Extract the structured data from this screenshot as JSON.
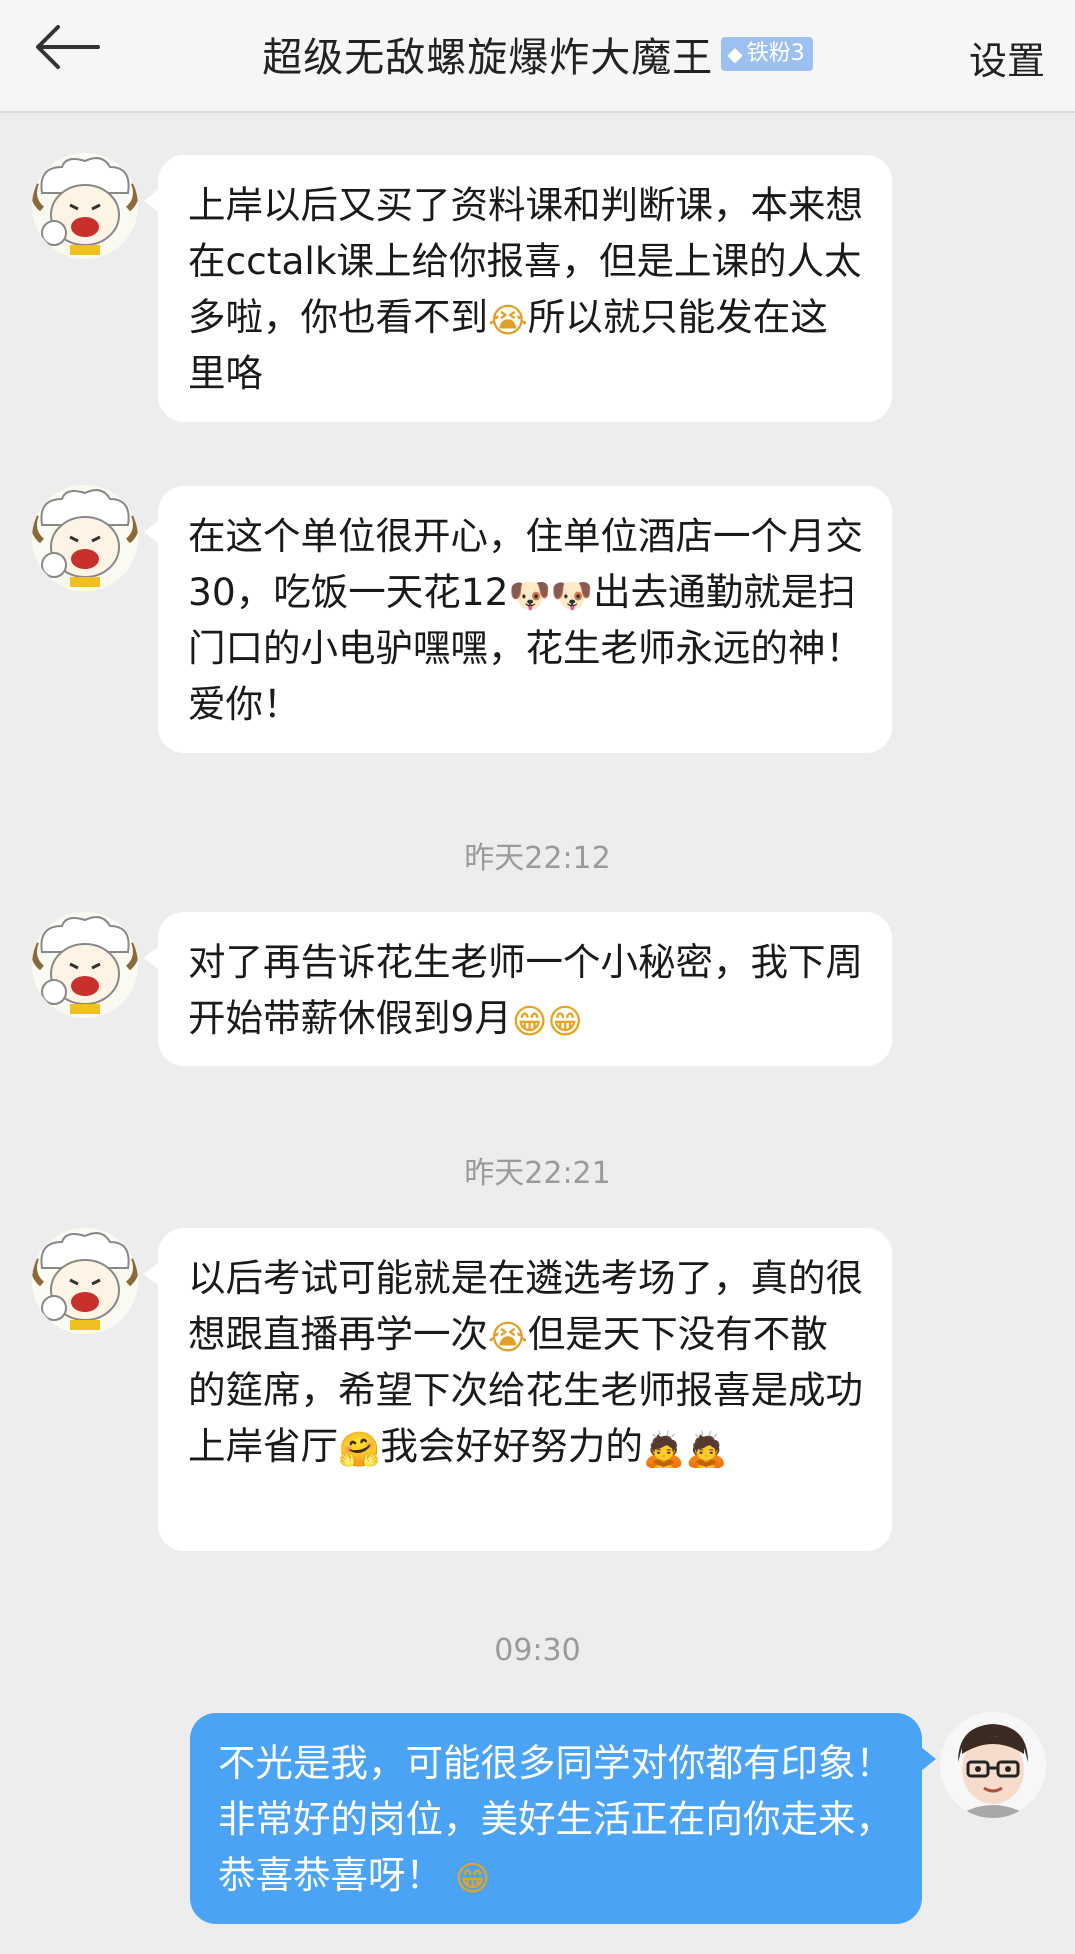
{
  "header": {
    "title": "超级无敌螺旋爆炸大魔王",
    "badge_icon": "◆",
    "badge_label": "铁粉3",
    "settings_label": "设置"
  },
  "messages": [
    {
      "side": "in",
      "parts": [
        "上岸以后又买了资料课和判断课，本来想在cctalk课上给你报喜，但是上课的人太多啦，你也看不到",
        {
          "emoji": "😭",
          "cls": "cry"
        },
        "所以就只能发在这里咯"
      ]
    },
    {
      "side": "in",
      "parts": [
        "在这个单位很开心，住单位酒店一个月交30，吃饭一天花12",
        {
          "emoji": "🐶",
          "cls": "dog"
        },
        {
          "emoji": "🐶",
          "cls": "dog"
        },
        "出去通勤就是扫门口的小电驴嘿嘿，花生老师永远的神！爱你！"
      ]
    },
    {
      "timestamp": "昨天22:12"
    },
    {
      "side": "in",
      "parts": [
        "对了再告诉花生老师一个小秘密，我下周开始带薪休假到9月",
        {
          "emoji": "😁",
          "cls": "laugh"
        },
        {
          "emoji": "😁",
          "cls": "laugh"
        }
      ]
    },
    {
      "timestamp": "昨天22:21"
    },
    {
      "side": "in",
      "parts": [
        "以后考试可能就是在遴选考场了，真的很想跟直播再学一次",
        {
          "emoji": "😭",
          "cls": "cry"
        },
        "但是天下没有不散的筵席，希望下次给花生老师报喜是成功上岸省厅",
        {
          "emoji": "🤗",
          "cls": "ppl"
        },
        "我会好好努力的",
        {
          "emoji": "🙇",
          "cls": "ppl"
        },
        {
          "emoji": "🙇",
          "cls": "ppl"
        }
      ]
    },
    {
      "timestamp": "09:30"
    },
    {
      "side": "out",
      "parts": [
        "不光是我，可能很多同学对你都有印象！非常好的岗位，美好生活正在向你走来，恭喜恭喜呀！ ",
        {
          "emoji": "😁",
          "cls": "laugh"
        }
      ]
    }
  ]
}
